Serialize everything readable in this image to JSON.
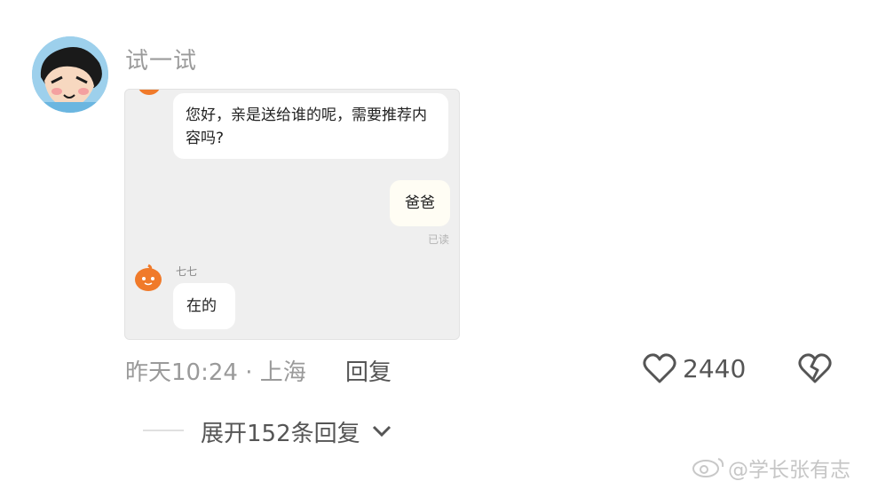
{
  "comment": {
    "username": "试一试",
    "avatar_icon": "crayon-shin-chan-avatar",
    "attachment": {
      "messages": [
        {
          "side": "left",
          "text": "您好，亲是送给谁的呢，需要推荐内容吗?"
        },
        {
          "side": "right",
          "text": "爸爸",
          "status": "已读"
        },
        {
          "side": "left",
          "sender": "七七",
          "text": "在的"
        }
      ]
    },
    "time_location": "昨天10:24 · 上海",
    "reply_label": "回复",
    "like_count": "2440",
    "expand_label": "展开152条回复"
  },
  "watermark": {
    "text": "@学长张有志"
  }
}
